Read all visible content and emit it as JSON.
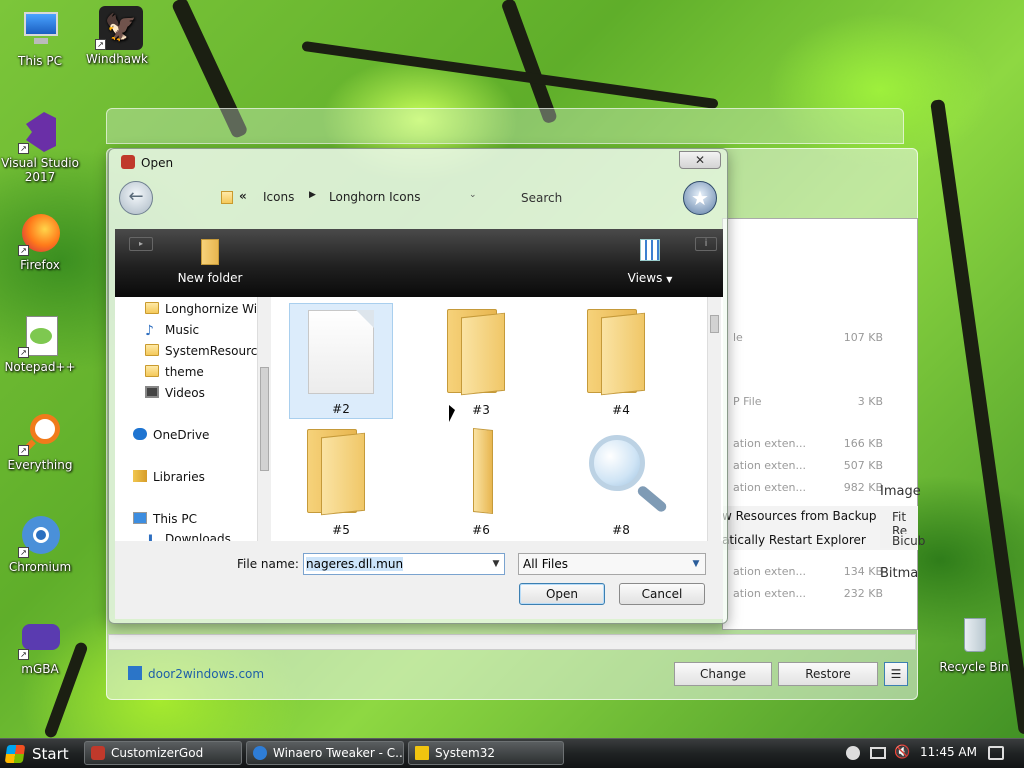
{
  "desktop": {
    "icons": [
      {
        "label": "This PC",
        "icon": "monitor-icon"
      },
      {
        "label": "Windhawk",
        "icon": "windhawk-icon"
      },
      {
        "label": "Visual Studio 2017",
        "icon": "visual-studio-icon"
      },
      {
        "label": "Firefox",
        "icon": "firefox-icon"
      },
      {
        "label": "Notepad++",
        "icon": "notepad-plus-plus-icon"
      },
      {
        "label": "Everything",
        "icon": "everything-search-icon"
      },
      {
        "label": "Chromium",
        "icon": "chromium-icon"
      },
      {
        "label": "mGBA",
        "icon": "mgba-icon"
      },
      {
        "label": "Recycle Bin",
        "icon": "recycle-bin-icon"
      }
    ]
  },
  "background_window": {
    "link": "door2windows.com",
    "buttons": {
      "change": "Change",
      "restore": "Restore"
    },
    "side_labels": [
      "Image",
      "Fit Re",
      "Bicub",
      "Bitma"
    ],
    "menu_items": [
      "w Resources from Backup",
      "atically Restart Explorer"
    ],
    "rows": [
      {
        "text": "le",
        "size": "107 KB"
      },
      {
        "text": "P File",
        "size": "3 KB"
      },
      {
        "text": "ation exten...",
        "size": "166 KB"
      },
      {
        "text": "ation exten...",
        "size": "507 KB"
      },
      {
        "text": "ation exten...",
        "size": "982 KB"
      },
      {
        "text": "ation exten...",
        "size": "134 KB"
      },
      {
        "text": "ation exten...",
        "size": "232 KB"
      }
    ]
  },
  "dialog": {
    "title": "Open",
    "close_label": "✕",
    "breadcrumb": [
      "Icons",
      "Longhorn Icons"
    ],
    "search_placeholder": "Search",
    "toolbar": {
      "new_folder": "New folder",
      "views": "Views"
    },
    "nav_items": [
      {
        "label": "Longhornize Win",
        "icon": "folder-icon"
      },
      {
        "label": "Music",
        "icon": "music-icon"
      },
      {
        "label": "SystemResources",
        "icon": "folder-icon"
      },
      {
        "label": "theme",
        "icon": "folder-icon"
      },
      {
        "label": "Videos",
        "icon": "videos-icon"
      },
      {
        "label": "OneDrive",
        "icon": "onedrive-icon"
      },
      {
        "label": "Libraries",
        "icon": "libraries-icon"
      },
      {
        "label": "This PC",
        "icon": "this-pc-icon"
      },
      {
        "label": "Downloads",
        "icon": "downloads-icon"
      }
    ],
    "files": [
      {
        "label": "#2",
        "kind": "document",
        "selected": true
      },
      {
        "label": "#3",
        "kind": "folder",
        "selected": false
      },
      {
        "label": "#4",
        "kind": "folder",
        "selected": false
      },
      {
        "label": "#5",
        "kind": "folder",
        "selected": false
      },
      {
        "label": "#6",
        "kind": "folder-thin",
        "selected": false
      },
      {
        "label": "#8",
        "kind": "magnifier",
        "selected": false
      }
    ],
    "file_name_label": "File name:",
    "file_name_value": "nageres.dll.mun",
    "filter_value": "All Files",
    "open_button": "Open",
    "cancel_button": "Cancel"
  },
  "taskbar": {
    "start": "Start",
    "tasks": [
      {
        "label": "CustomizerGod",
        "color": "#c0392b"
      },
      {
        "label": "Winaero Tweaker - C...",
        "color": "#2e7dd7"
      },
      {
        "label": "System32",
        "color": "#f1c40f"
      }
    ],
    "clock": "11:45 AM"
  }
}
